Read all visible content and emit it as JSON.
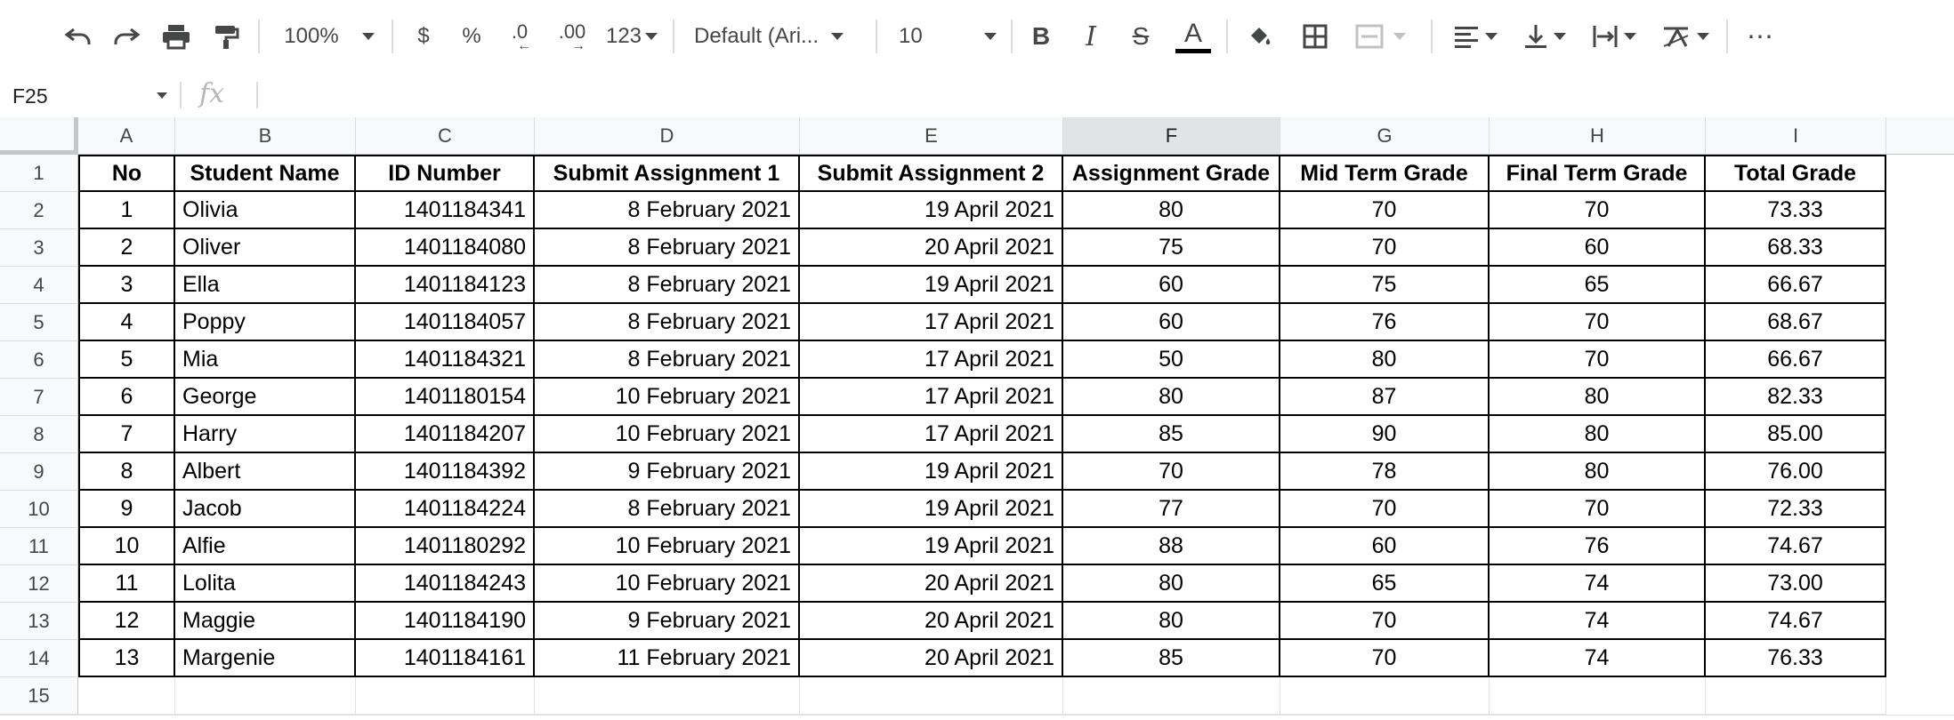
{
  "toolbar": {
    "zoom": "100%",
    "currency": "$",
    "percent": "%",
    "decrease_decimal": ".0",
    "increase_decimal": ".00",
    "more_formats": "123",
    "font": "Default (Ari...",
    "font_size": "10",
    "bold": "B",
    "italic": "I",
    "strike": "S",
    "text_color": "A",
    "more": "⋯"
  },
  "formula_bar": {
    "name_box": "F25",
    "fx": "fx",
    "formula": ""
  },
  "columns": [
    "A",
    "B",
    "C",
    "D",
    "E",
    "F",
    "G",
    "H",
    "I"
  ],
  "selected_column": "F",
  "row_numbers": [
    "1",
    "2",
    "3",
    "4",
    "5",
    "6",
    "7",
    "8",
    "9",
    "10",
    "11",
    "12",
    "13",
    "14",
    "15"
  ],
  "table": {
    "headers": [
      "No",
      "Student Name",
      "ID Number",
      "Submit Assignment 1",
      "Submit Assignment 2",
      "Assignment Grade",
      "Mid Term Grade",
      "Final Term Grade",
      "Total Grade"
    ],
    "rows": [
      [
        "1",
        "Olivia",
        "1401184341",
        "8 February 2021",
        "19 April 2021",
        "80",
        "70",
        "70",
        "73.33"
      ],
      [
        "2",
        "Oliver",
        "1401184080",
        "8 February 2021",
        "20 April 2021",
        "75",
        "70",
        "60",
        "68.33"
      ],
      [
        "3",
        "Ella",
        "1401184123",
        "8 February 2021",
        "19 April 2021",
        "60",
        "75",
        "65",
        "66.67"
      ],
      [
        "4",
        "Poppy",
        "1401184057",
        "8 February 2021",
        "17 April 2021",
        "60",
        "76",
        "70",
        "68.67"
      ],
      [
        "5",
        "Mia",
        "1401184321",
        "8 February 2021",
        "17 April 2021",
        "50",
        "80",
        "70",
        "66.67"
      ],
      [
        "6",
        "George",
        "1401180154",
        "10 February 2021",
        "17 April 2021",
        "80",
        "87",
        "80",
        "82.33"
      ],
      [
        "7",
        "Harry",
        "1401184207",
        "10 February 2021",
        "17 April 2021",
        "85",
        "90",
        "80",
        "85.00"
      ],
      [
        "8",
        "Albert",
        "1401184392",
        "9 February 2021",
        "19 April 2021",
        "70",
        "78",
        "80",
        "76.00"
      ],
      [
        "9",
        "Jacob",
        "1401184224",
        "8 February 2021",
        "19 April 2021",
        "77",
        "70",
        "70",
        "72.33"
      ],
      [
        "10",
        "Alfie",
        "1401180292",
        "10 February 2021",
        "19 April 2021",
        "88",
        "60",
        "76",
        "74.67"
      ],
      [
        "11",
        "Lolita",
        "1401184243",
        "10 February 2021",
        "20 April 2021",
        "80",
        "65",
        "74",
        "73.00"
      ],
      [
        "12",
        "Maggie",
        "1401184190",
        "9 February 2021",
        "20 April 2021",
        "80",
        "70",
        "74",
        "74.67"
      ],
      [
        "13",
        "Margenie",
        "1401184161",
        "11 February 2021",
        "20 April 2021",
        "85",
        "70",
        "74",
        "76.33"
      ]
    ]
  },
  "colors": {
    "toolbar_icon": "#444746",
    "header_bg": "#f8f9fa",
    "selected_header_bg": "#e1e3e6",
    "table_border": "#000000",
    "gridline": "#e2e2e2"
  }
}
